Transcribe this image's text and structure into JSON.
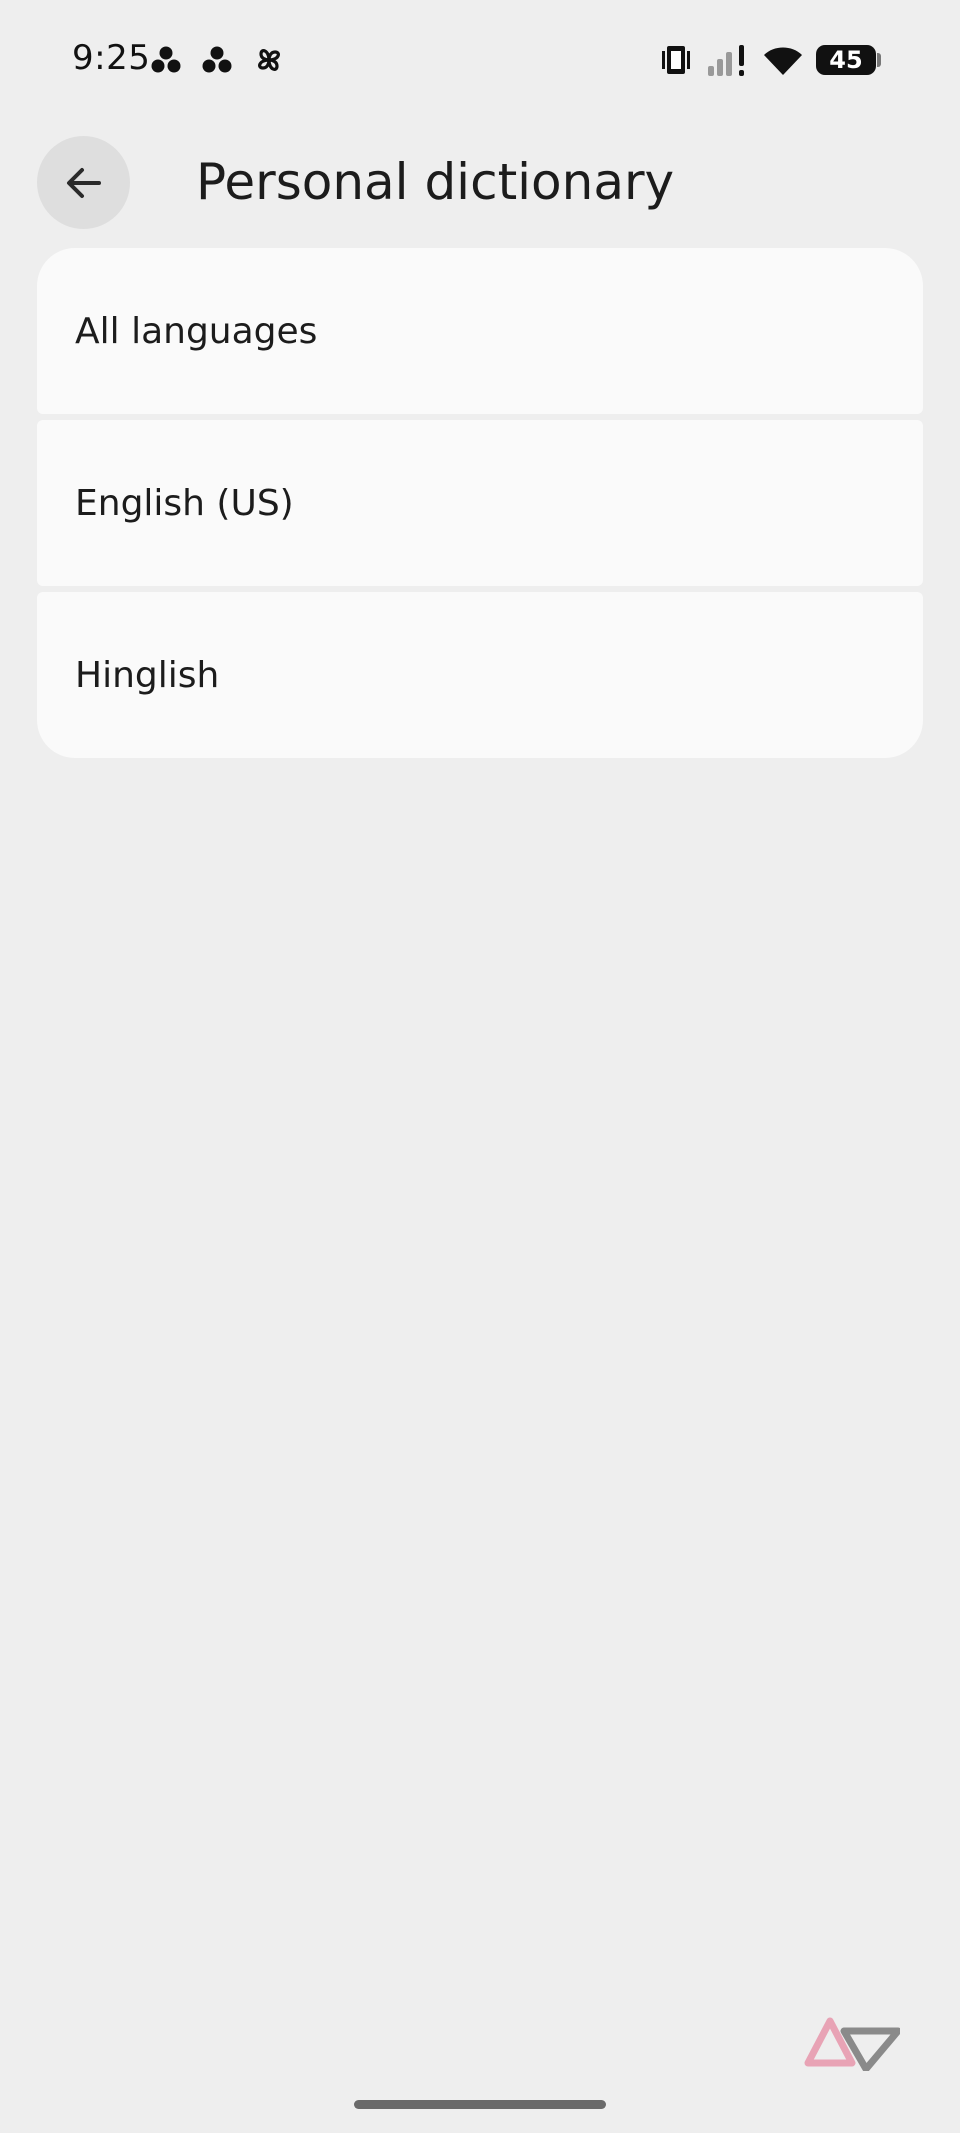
{
  "status_bar": {
    "time": "9:25",
    "battery_level": "45",
    "icons": [
      "dots-icon",
      "dots-icon",
      "pinwheel-icon",
      "vibrate-icon",
      "signal-icon",
      "wifi-icon",
      "battery-icon"
    ]
  },
  "header": {
    "title": "Personal dictionary",
    "back_icon": "arrow-back-icon"
  },
  "languages": [
    {
      "label": "All languages"
    },
    {
      "label": "English (US)"
    },
    {
      "label": "Hinglish"
    }
  ],
  "colors": {
    "background": "#eeeeee",
    "card": "#fafafa",
    "back_button_bg": "#dedede",
    "watermark_pink": "#e8a3b5",
    "watermark_gray": "#8a8a8a"
  }
}
